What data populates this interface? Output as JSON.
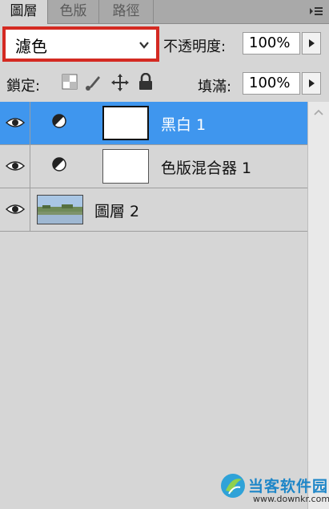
{
  "tabs": [
    {
      "label": "圖層",
      "active": true
    },
    {
      "label": "色版",
      "active": false
    },
    {
      "label": "路徑",
      "active": false
    }
  ],
  "blend_mode": {
    "value": "濾色"
  },
  "opacity": {
    "label": "不透明度:",
    "value": "100%"
  },
  "lock": {
    "label": "鎖定:",
    "icons": [
      "lock-transparent-pixels-icon",
      "lock-image-pixels-icon",
      "lock-position-icon",
      "lock-all-icon"
    ]
  },
  "fill": {
    "label": "填滿:",
    "value": "100%"
  },
  "layers": [
    {
      "name": "黑白 1",
      "type": "adjustment",
      "selected": true,
      "visible": true
    },
    {
      "name": "色版混合器 1",
      "type": "adjustment",
      "selected": false,
      "visible": true
    },
    {
      "name": "圖層 2",
      "type": "image",
      "selected": false,
      "visible": true
    }
  ],
  "watermark": {
    "title": "当客软件园",
    "url": "www.downkr.com"
  },
  "colors": {
    "selection": "#3f96ee",
    "highlight_border": "#d42a22",
    "panel_bg": "#d6d6d6"
  }
}
